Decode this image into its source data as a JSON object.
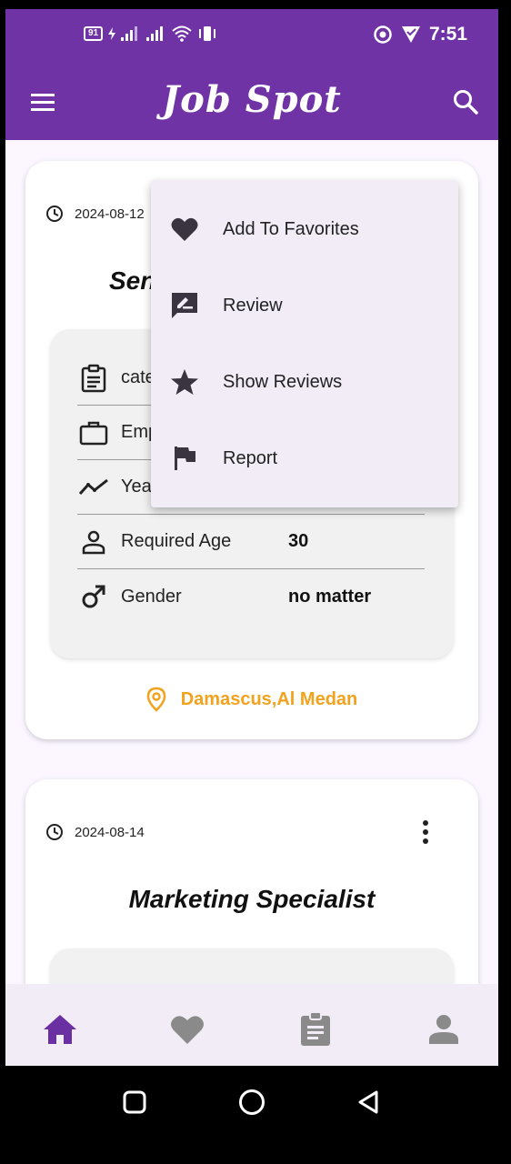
{
  "status_bar": {
    "battery_level": "91",
    "time": "7:51"
  },
  "app_bar": {
    "title": "Job Spot",
    "menu_icon": "hamburger-icon",
    "search_icon": "search-icon"
  },
  "jobs": [
    {
      "date": "2024-08-12",
      "title_partial": "Sen",
      "rows": [
        {
          "icon": "clipboard-icon",
          "label": "cate",
          "value": ""
        },
        {
          "icon": "briefcase-icon",
          "label": "Emp",
          "value": ""
        },
        {
          "icon": "trending-icon",
          "label": "Yea",
          "value": ""
        },
        {
          "icon": "person-icon",
          "label": "Required Age",
          "value": "30"
        },
        {
          "icon": "male-icon",
          "label": "Gender",
          "value": "no matter"
        }
      ],
      "location": "Damascus,Al Medan"
    },
    {
      "date": "2024-08-14",
      "title": "Marketing Specialist"
    }
  ],
  "popup_menu": {
    "items": [
      {
        "icon": "heart-icon",
        "label": "Add To Favorites"
      },
      {
        "icon": "review-icon",
        "label": "Review"
      },
      {
        "icon": "star-icon",
        "label": "Show Reviews"
      },
      {
        "icon": "flag-icon",
        "label": "Report"
      }
    ]
  },
  "bottom_nav": {
    "items": [
      {
        "icon": "home-icon",
        "active": true
      },
      {
        "icon": "heart-icon",
        "active": false
      },
      {
        "icon": "clipboard-icon",
        "active": false
      },
      {
        "icon": "person-icon",
        "active": false
      }
    ]
  },
  "colors": {
    "primary": "#7033a6",
    "accent_location": "#f2a21d",
    "nav_inactive": "#8a8a8a"
  }
}
